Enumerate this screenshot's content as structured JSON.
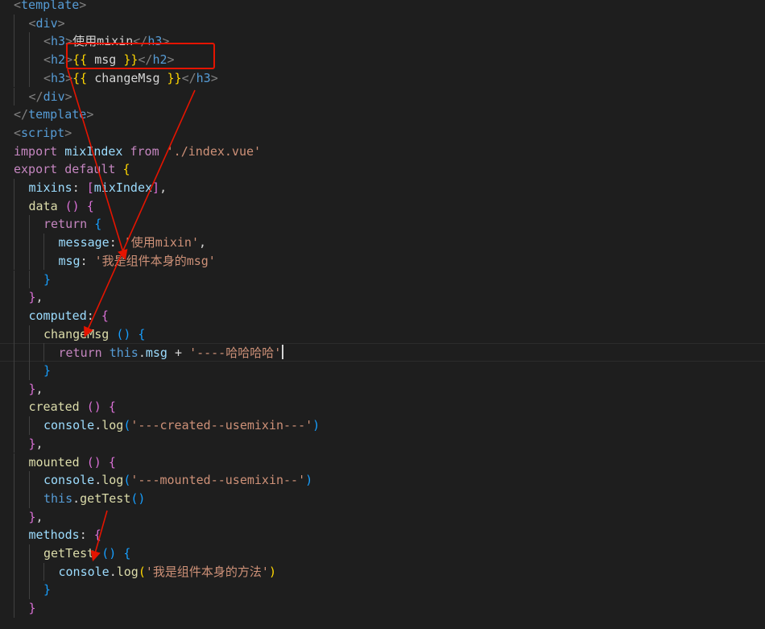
{
  "colors": {
    "background": "#1e1e1e",
    "tag_bracket": "#808080",
    "tag_name": "#569cd6",
    "text": "#d4d4d4",
    "mustache": "#ffd700",
    "property": "#9cdcfe",
    "keyword": "#c586c0",
    "string": "#ce9178",
    "function": "#dcdcaa",
    "this": "#569cd6",
    "bracket_gold": "#ffd700",
    "bracket_purple": "#da70d6",
    "bracket_blue": "#179fff",
    "annotation_red": "#e51400"
  },
  "editor": {
    "cursor_line_index": 19,
    "lines": [
      {
        "indent": 0,
        "tokens": [
          [
            "tag_bracket",
            "<"
          ],
          [
            "tag_name",
            "template"
          ],
          [
            "tag_bracket",
            ">"
          ]
        ]
      },
      {
        "indent": 1,
        "tokens": [
          [
            "tag_bracket",
            "<"
          ],
          [
            "tag_name",
            "div"
          ],
          [
            "tag_bracket",
            ">"
          ]
        ]
      },
      {
        "indent": 2,
        "tokens": [
          [
            "tag_bracket",
            "<"
          ],
          [
            "tag_name",
            "h3"
          ],
          [
            "tag_bracket",
            ">"
          ],
          [
            "text",
            "使用mixin"
          ],
          [
            "tag_bracket",
            "</"
          ],
          [
            "tag_name",
            "h3"
          ],
          [
            "tag_bracket",
            ">"
          ]
        ]
      },
      {
        "indent": 2,
        "tokens": [
          [
            "tag_bracket",
            "<"
          ],
          [
            "tag_name",
            "h2"
          ],
          [
            "tag_bracket",
            ">"
          ],
          [
            "mustache",
            "{{"
          ],
          [
            "text",
            " msg "
          ],
          [
            "mustache",
            "}}"
          ],
          [
            "tag_bracket",
            "</"
          ],
          [
            "tag_name",
            "h2"
          ],
          [
            "tag_bracket",
            ">"
          ]
        ]
      },
      {
        "indent": 2,
        "tokens": [
          [
            "tag_bracket",
            "<"
          ],
          [
            "tag_name",
            "h3"
          ],
          [
            "tag_bracket",
            ">"
          ],
          [
            "mustache",
            "{{"
          ],
          [
            "text",
            " changeMsg "
          ],
          [
            "mustache",
            "}}"
          ],
          [
            "tag_bracket",
            "</"
          ],
          [
            "tag_name",
            "h3"
          ],
          [
            "tag_bracket",
            ">"
          ]
        ]
      },
      {
        "indent": 1,
        "tokens": [
          [
            "tag_bracket",
            "</"
          ],
          [
            "tag_name",
            "div"
          ],
          [
            "tag_bracket",
            ">"
          ]
        ]
      },
      {
        "indent": 0,
        "tokens": [
          [
            "tag_bracket",
            "</"
          ],
          [
            "tag_name",
            "template"
          ],
          [
            "tag_bracket",
            ">"
          ]
        ]
      },
      {
        "indent": 0,
        "tokens": [
          [
            "tag_bracket",
            "<"
          ],
          [
            "tag_name",
            "script"
          ],
          [
            "tag_bracket",
            ">"
          ]
        ]
      },
      {
        "indent": 0,
        "tokens": [
          [
            "keyword",
            "import"
          ],
          [
            "text",
            " "
          ],
          [
            "property",
            "mixIndex"
          ],
          [
            "text",
            " "
          ],
          [
            "keyword",
            "from"
          ],
          [
            "text",
            " "
          ],
          [
            "string",
            "'./index.vue'"
          ]
        ]
      },
      {
        "indent": 0,
        "tokens": [
          [
            "keyword",
            "export"
          ],
          [
            "text",
            " "
          ],
          [
            "keyword",
            "default"
          ],
          [
            "text",
            " "
          ],
          [
            "bracket_gold",
            "{"
          ]
        ]
      },
      {
        "indent": 1,
        "tokens": [
          [
            "property",
            "mixins"
          ],
          [
            "text",
            ": "
          ],
          [
            "bracket_purple",
            "["
          ],
          [
            "property",
            "mixIndex"
          ],
          [
            "bracket_purple",
            "]"
          ],
          [
            "text",
            ","
          ]
        ]
      },
      {
        "indent": 1,
        "tokens": [
          [
            "function",
            "data"
          ],
          [
            "text",
            " "
          ],
          [
            "bracket_purple",
            "()"
          ],
          [
            "text",
            " "
          ],
          [
            "bracket_purple",
            "{"
          ]
        ]
      },
      {
        "indent": 2,
        "tokens": [
          [
            "keyword",
            "return"
          ],
          [
            "text",
            " "
          ],
          [
            "bracket_blue",
            "{"
          ]
        ]
      },
      {
        "indent": 3,
        "tokens": [
          [
            "property",
            "message"
          ],
          [
            "text",
            ": "
          ],
          [
            "string",
            "'使用mixin'"
          ],
          [
            "text",
            ","
          ]
        ]
      },
      {
        "indent": 3,
        "tokens": [
          [
            "property",
            "msg"
          ],
          [
            "text",
            ": "
          ],
          [
            "string",
            "'我是组件本身的msg'"
          ]
        ]
      },
      {
        "indent": 2,
        "tokens": [
          [
            "bracket_blue",
            "}"
          ]
        ]
      },
      {
        "indent": 1,
        "tokens": [
          [
            "bracket_purple",
            "}"
          ],
          [
            "text",
            ","
          ]
        ]
      },
      {
        "indent": 1,
        "tokens": [
          [
            "property",
            "computed"
          ],
          [
            "text",
            ": "
          ],
          [
            "bracket_purple",
            "{"
          ]
        ]
      },
      {
        "indent": 2,
        "tokens": [
          [
            "function",
            "changeMsg"
          ],
          [
            "text",
            " "
          ],
          [
            "bracket_blue",
            "()"
          ],
          [
            "text",
            " "
          ],
          [
            "bracket_blue",
            "{"
          ]
        ]
      },
      {
        "indent": 3,
        "tokens": [
          [
            "keyword",
            "return"
          ],
          [
            "text",
            " "
          ],
          [
            "this",
            "this"
          ],
          [
            "text",
            "."
          ],
          [
            "property",
            "msg"
          ],
          [
            "text",
            " + "
          ],
          [
            "string",
            "'----哈哈哈哈'"
          ]
        ]
      },
      {
        "indent": 2,
        "tokens": [
          [
            "bracket_blue",
            "}"
          ]
        ]
      },
      {
        "indent": 1,
        "tokens": [
          [
            "bracket_purple",
            "}"
          ],
          [
            "text",
            ","
          ]
        ]
      },
      {
        "indent": 1,
        "tokens": [
          [
            "function",
            "created"
          ],
          [
            "text",
            " "
          ],
          [
            "bracket_purple",
            "()"
          ],
          [
            "text",
            " "
          ],
          [
            "bracket_purple",
            "{"
          ]
        ]
      },
      {
        "indent": 2,
        "tokens": [
          [
            "property",
            "console"
          ],
          [
            "text",
            "."
          ],
          [
            "function",
            "log"
          ],
          [
            "bracket_blue",
            "("
          ],
          [
            "string",
            "'---created--usemixin---'"
          ],
          [
            "bracket_blue",
            ")"
          ]
        ]
      },
      {
        "indent": 1,
        "tokens": [
          [
            "bracket_purple",
            "}"
          ],
          [
            "text",
            ","
          ]
        ]
      },
      {
        "indent": 1,
        "tokens": [
          [
            "function",
            "mounted"
          ],
          [
            "text",
            " "
          ],
          [
            "bracket_purple",
            "()"
          ],
          [
            "text",
            " "
          ],
          [
            "bracket_purple",
            "{"
          ]
        ]
      },
      {
        "indent": 2,
        "tokens": [
          [
            "property",
            "console"
          ],
          [
            "text",
            "."
          ],
          [
            "function",
            "log"
          ],
          [
            "bracket_blue",
            "("
          ],
          [
            "string",
            "'---mounted--usemixin--'"
          ],
          [
            "bracket_blue",
            ")"
          ]
        ]
      },
      {
        "indent": 2,
        "tokens": [
          [
            "this",
            "this"
          ],
          [
            "text",
            "."
          ],
          [
            "function",
            "getTest"
          ],
          [
            "bracket_blue",
            "()"
          ]
        ]
      },
      {
        "indent": 1,
        "tokens": [
          [
            "bracket_purple",
            "}"
          ],
          [
            "text",
            ","
          ]
        ]
      },
      {
        "indent": 1,
        "tokens": [
          [
            "property",
            "methods"
          ],
          [
            "text",
            ": "
          ],
          [
            "bracket_purple",
            "{"
          ]
        ]
      },
      {
        "indent": 2,
        "tokens": [
          [
            "function",
            "getTest"
          ],
          [
            "text",
            " "
          ],
          [
            "bracket_blue",
            "()"
          ],
          [
            "text",
            " "
          ],
          [
            "bracket_blue",
            "{"
          ]
        ]
      },
      {
        "indent": 3,
        "tokens": [
          [
            "property",
            "console"
          ],
          [
            "text",
            "."
          ],
          [
            "function",
            "log"
          ],
          [
            "bracket_gold",
            "("
          ],
          [
            "string",
            "'我是组件本身的方法'"
          ],
          [
            "bracket_gold",
            ")"
          ]
        ]
      },
      {
        "indent": 2,
        "tokens": [
          [
            "bracket_blue",
            "}"
          ]
        ]
      },
      {
        "indent": 1,
        "tokens": [
          [
            "bracket_purple",
            "}"
          ]
        ]
      }
    ]
  }
}
